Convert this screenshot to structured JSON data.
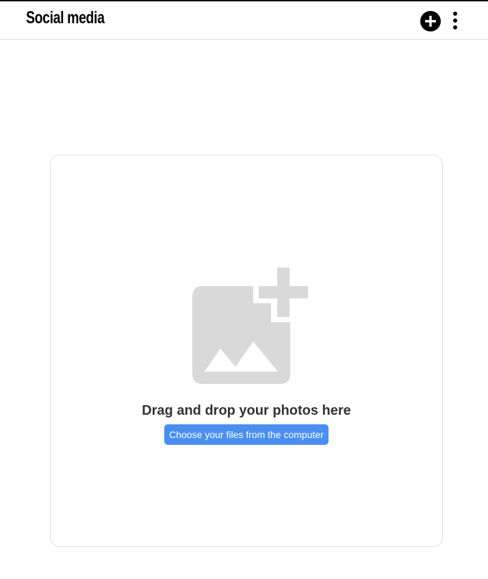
{
  "header": {
    "title": "Social media",
    "add_icon": "plus-circle-icon",
    "more_icon": "vertical-dots-icon"
  },
  "dropzone": {
    "icon": "add-photo-icon",
    "title": "Drag and drop your photos here",
    "choose_button_label": "Choose your files from the computer"
  },
  "colors": {
    "accent": "#4a8ff0",
    "icon_gray": "#d9d9d9",
    "border": "#dcdcdc",
    "text_dark": "#333333"
  }
}
